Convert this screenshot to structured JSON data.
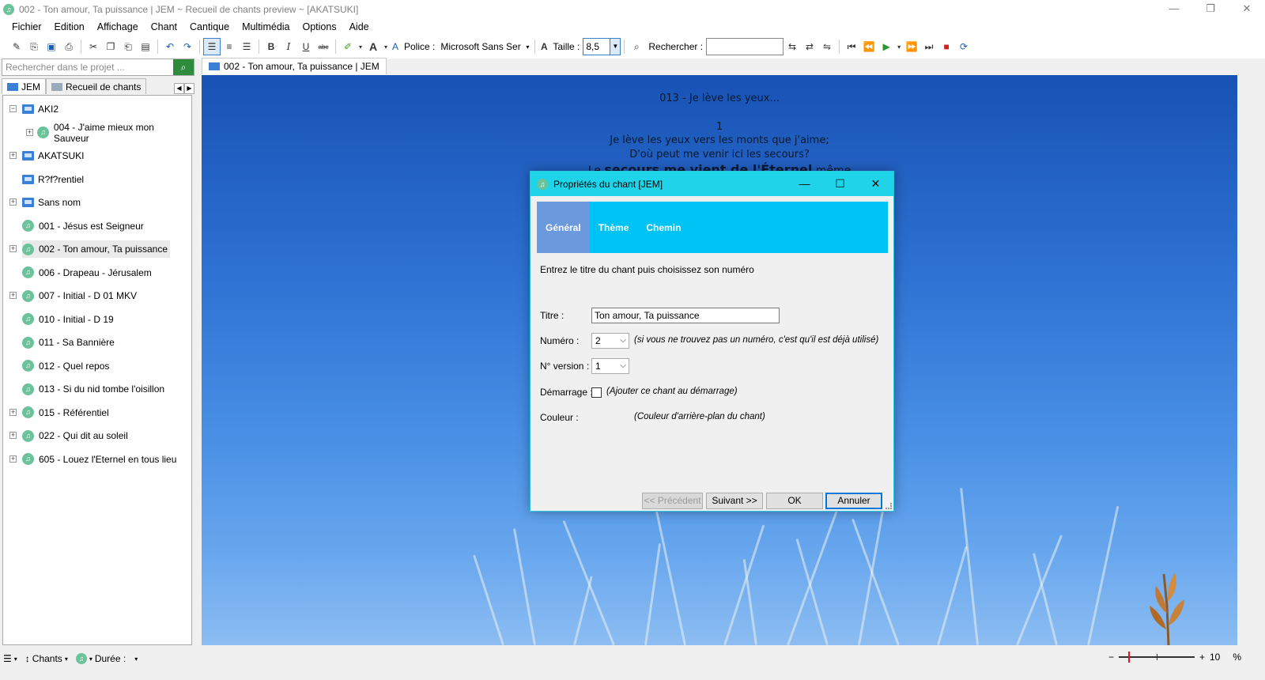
{
  "window": {
    "title": "002 - Ton amour, Ta puissance | JEM ~ Recueil de chants preview ~ [AKATSUKI]",
    "min": "—",
    "max": "❐",
    "close": "✕"
  },
  "menu": [
    "Fichier",
    "Edition",
    "Affichage",
    "Chant",
    "Cantique",
    "Multimédia",
    "Options",
    "Aide"
  ],
  "toolbar": {
    "police_label": "Police :",
    "font_value": "Microsoft Sans Ser",
    "taille_label": "Taille :",
    "size_value": "8,5",
    "search_label": "Rechercher :",
    "search_value": ""
  },
  "left_panel": {
    "search_placeholder": "Rechercher dans le projet ...",
    "tabs": [
      "JEM",
      "Recueil de chants"
    ],
    "tree": [
      {
        "label": "AKI2",
        "type": "folder",
        "expanded": true,
        "level": 0
      },
      {
        "label": "004 - J'aime mieux mon Sauveur",
        "type": "song",
        "expandable": true,
        "level": 1
      },
      {
        "label": "AKATSUKI",
        "type": "folder",
        "expandable": true,
        "level": 0
      },
      {
        "label": "R?f?rentiel",
        "type": "folder",
        "expandable": false,
        "level": 0
      },
      {
        "label": "Sans nom",
        "type": "folder",
        "expandable": true,
        "level": 0
      },
      {
        "label": "001 - Jésus est Seigneur",
        "type": "song",
        "expandable": false,
        "level": 0
      },
      {
        "label": "002 - Ton amour, Ta puissance",
        "type": "song",
        "expandable": true,
        "level": 0,
        "selected": true
      },
      {
        "label": "006 - Drapeau - Jérusalem",
        "type": "song",
        "expandable": false,
        "level": 0
      },
      {
        "label": "007 - Initial - D 01 MKV",
        "type": "song",
        "expandable": true,
        "level": 0
      },
      {
        "label": "010 - Initial  - D 19",
        "type": "song",
        "expandable": false,
        "level": 0
      },
      {
        "label": "011 - Sa Bannière",
        "type": "song",
        "expandable": false,
        "level": 0
      },
      {
        "label": "012 - Quel repos",
        "type": "song",
        "expandable": false,
        "level": 0
      },
      {
        "label": "013 - Si du nid tombe l'oisillon",
        "type": "song",
        "expandable": false,
        "level": 0
      },
      {
        "label": "015 - Référentiel",
        "type": "song",
        "expandable": true,
        "level": 0
      },
      {
        "label": "022 - Qui dit au soleil",
        "type": "song",
        "expandable": true,
        "level": 0
      },
      {
        "label": "605 - Louez l'Eternel en tous lieu",
        "type": "song",
        "expandable": true,
        "level": 0
      }
    ]
  },
  "doc_tab": "002 - Ton amour, Ta puissance | JEM",
  "preview": {
    "heading": "013 - Je lève les yeux...",
    "verse_number": "1",
    "lines": [
      "Je lève les yeux vers les monts que j'aime;",
      "D'où peut me venir ici les secours?"
    ],
    "partial_line_a": "Le ",
    "partial_line_b": "secours me vient de l'Éternel",
    "partial_line_c": " même"
  },
  "dialog": {
    "title": "Propriétés du chant [JEM]",
    "tabs": [
      "Général",
      "Thème",
      "Chemin"
    ],
    "intro": "Entrez le titre du chant puis choisissez son numéro",
    "titre_label": "Titre :",
    "titre_value": "Ton amour, Ta puissance",
    "numero_label": "Numéro :",
    "numero_value": "2",
    "numero_hint": "(si vous ne trouvez pas un numéro, c'est qu'il est déjà utilisé)",
    "version_label": "N° version :",
    "version_value": "1",
    "demarrage_label": "Démarrage :",
    "demarrage_hint": "(Ajouter ce chant au démarrage)",
    "couleur_label": "Couleur :",
    "couleur_hint": "(Couleur d'arrière-plan du chant)",
    "btn_prev": "<< Précédent",
    "btn_next": "Suivant >>",
    "btn_ok": "OK",
    "btn_cancel": "Annuler"
  },
  "statusbar": {
    "chants_label": "Chants",
    "duree_label": "Durée :",
    "zoom_minus": "−",
    "zoom_plus": "+",
    "zoom_value": "10",
    "zoom_unit": "%"
  },
  "colors": {
    "accent": "#1fd3e8",
    "dialog_tabs": "#00c3f5",
    "dialog_tab_selected": "#6b99de",
    "song_icon": "#6cc29b"
  }
}
